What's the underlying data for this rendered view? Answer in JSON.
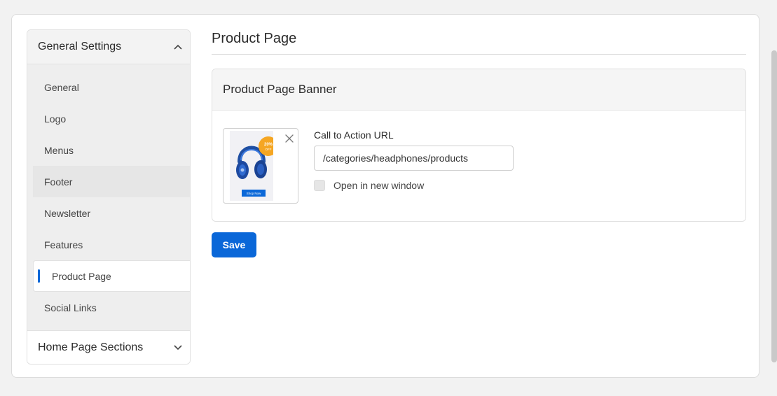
{
  "sidebar": {
    "section_title": "General Settings",
    "items": [
      {
        "label": "General"
      },
      {
        "label": "Logo"
      },
      {
        "label": "Menus"
      },
      {
        "label": "Footer"
      },
      {
        "label": "Newsletter"
      },
      {
        "label": "Features"
      },
      {
        "label": "Product Page"
      },
      {
        "label": "Social Links"
      }
    ],
    "active_item": "Product Page",
    "bottom_section_title": "Home Page Sections"
  },
  "main": {
    "page_title": "Product Page",
    "panel": {
      "title": "Product Page Banner",
      "banner": {
        "badge_text": "20%",
        "badge_sub": "OFF",
        "cta_text": "Shop Now",
        "icon": "headphones-image"
      },
      "url_field": {
        "label": "Call to Action URL",
        "value": "/categories/headphones/products"
      },
      "new_window": {
        "label": "Open in new window",
        "checked": false
      }
    },
    "save_label": "Save"
  },
  "colors": {
    "accent": "#0a67d8",
    "badge": "#f5a623",
    "background": "#f2f2f2"
  }
}
